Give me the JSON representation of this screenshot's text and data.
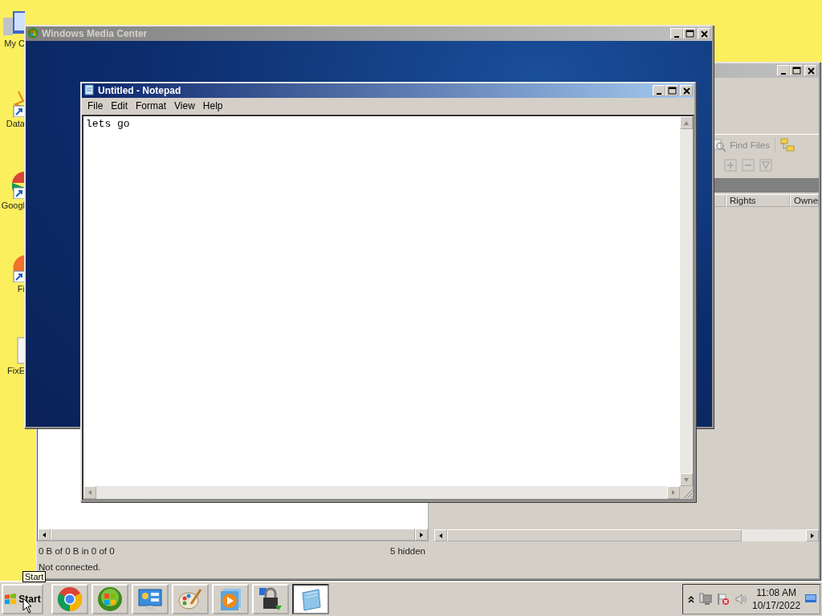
{
  "desktop_icons": [
    {
      "kind": "computer",
      "label": "My C"
    },
    {
      "kind": "data",
      "label": "Data"
    },
    {
      "kind": "chrome",
      "label": "Googl"
    },
    {
      "kind": "firefox",
      "label": "Fi"
    },
    {
      "kind": "file",
      "label": "FixE"
    }
  ],
  "file_manager": {
    "toolbar": {
      "find_files": "Find Files"
    },
    "columns": [
      "Rights",
      "Owne"
    ],
    "status": {
      "summary": "0 B of 0 B in 0 of 0",
      "hidden": "5 hidden",
      "connection": "Not connected."
    }
  },
  "media_center": {
    "title": "Windows Media Center"
  },
  "notepad": {
    "title": "Untitled - Notepad",
    "menu": [
      "File",
      "Edit",
      "Format",
      "View",
      "Help"
    ],
    "text": "lets go"
  },
  "taskbar": {
    "start": "Start",
    "tooltip": "Start",
    "apps": [
      {
        "kind": "chrome",
        "selected": false
      },
      {
        "kind": "orb",
        "selected": false
      },
      {
        "kind": "control-panel",
        "selected": false
      },
      {
        "kind": "paint",
        "selected": false
      },
      {
        "kind": "player",
        "selected": false
      },
      {
        "kind": "lock",
        "selected": false
      },
      {
        "kind": "notepad",
        "selected": true
      }
    ],
    "clock": {
      "time": "11:08 AM",
      "date": "10/17/2022"
    }
  }
}
